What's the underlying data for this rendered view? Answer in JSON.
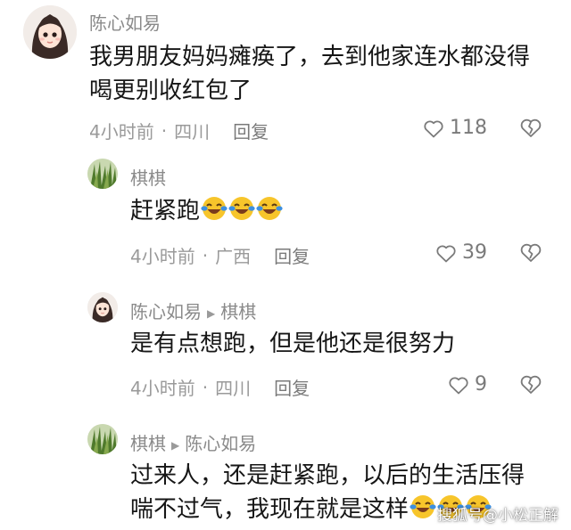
{
  "comments": [
    {
      "username": "陈心如易",
      "text": "我男朋友妈妈瘫痪了，去到他家连水都没得喝更别收红包了",
      "time": "4小时前",
      "location": "四川",
      "reply_label": "回复",
      "likes": "118"
    },
    {
      "username": "棋棋",
      "text": "赶紧跑",
      "time": "4小时前",
      "location": "广西",
      "reply_label": "回复",
      "likes": "39"
    },
    {
      "username": "陈心如易",
      "reply_to": "棋棋",
      "text": "是有点想跑，但是他还是很努力",
      "time": "4小时前",
      "location": "四川",
      "reply_label": "回复",
      "likes": "9"
    },
    {
      "username": "棋棋",
      "reply_to": "陈心如易",
      "text": "过来人，还是赶紧跑，以后的生活压得喘不过气，我现在就是这样"
    }
  ],
  "icons": {
    "like": "heart-icon",
    "dislike": "broken-heart-icon",
    "emoji": "laughing-crying-emoji"
  },
  "watermark": "搜狐号@小松正解",
  "colors": {
    "text": "#161616",
    "meta": "#9a9a9a",
    "emoji_face": "#f7c52b",
    "emoji_tear": "#3d8fe0"
  }
}
